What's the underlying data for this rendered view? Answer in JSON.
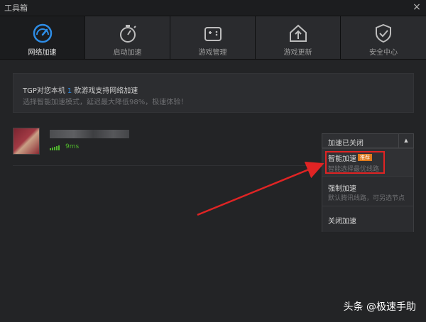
{
  "window": {
    "title": "工具箱",
    "close_symbol": "×"
  },
  "tabs": [
    {
      "label": "网络加速",
      "icon": "speedometer-icon",
      "active": true
    },
    {
      "label": "启动加速",
      "icon": "stopwatch-icon",
      "active": false
    },
    {
      "label": "游戏管理",
      "icon": "gamepad-icon",
      "active": false
    },
    {
      "label": "游戏更新",
      "icon": "home-upload-icon",
      "active": false
    },
    {
      "label": "安全中心",
      "icon": "shield-check-icon",
      "active": false
    }
  ],
  "notice": {
    "line1_prefix": "TGP对您本机",
    "line1_count": "1",
    "line1_suffix": "款游戏支持网络加速",
    "line2": "选择智能加速模式，延迟最大降低98%，极速体验！"
  },
  "game": {
    "ping": "9ms",
    "ping_color": "#4fb52c"
  },
  "dropdown": {
    "selected": "加速已关闭",
    "options": [
      {
        "name": "智能加速",
        "badge": "推荐",
        "desc": "智能选择最优线路"
      },
      {
        "name": "强制加速",
        "desc": "默认腾讯线路，可另选节点"
      },
      {
        "name": "关闭加速"
      }
    ]
  },
  "watermark": "头条 @极速手助",
  "colors": {
    "accent": "#2e8de6",
    "highlight": "#e02424",
    "badge": "#e07a1c"
  }
}
